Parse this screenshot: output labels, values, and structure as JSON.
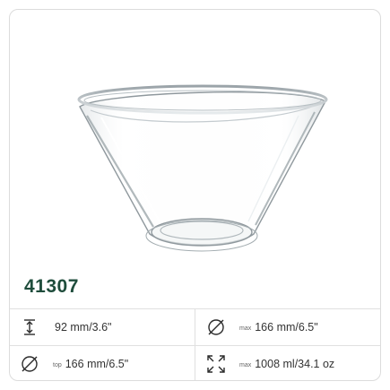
{
  "product": {
    "code": "41307",
    "image_label": "glass bowl"
  },
  "specs": [
    {
      "icon": "height-icon",
      "prefix": "",
      "value": "92 mm/3.6\""
    },
    {
      "icon": "diameter-icon",
      "prefix": "max",
      "value": "166 mm/6.5\""
    },
    {
      "icon": "diameter-icon",
      "prefix": "top",
      "value": "166 mm/6.5\""
    },
    {
      "icon": "capacity-icon",
      "prefix": "max",
      "value": "1008 ml/34.1 oz"
    }
  ],
  "colors": {
    "brand_green": "#1f4d3c",
    "icon_color": "#2b2b2b",
    "border": "#e0e0e0"
  }
}
